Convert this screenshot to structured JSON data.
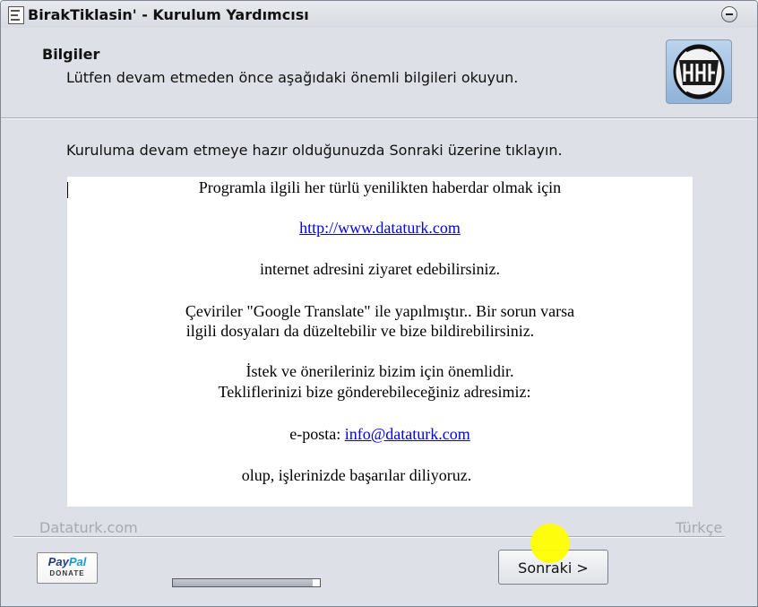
{
  "window": {
    "title": "BirakTiklasin' - Kurulum Yardımcısı",
    "icon": "installer-app-icon",
    "controls": [
      "minimize-icon"
    ]
  },
  "header": {
    "title": "Bilgiler",
    "subtitle": "Lütfen devam etmeden önce aşağıdaki önemli bilgileri okuyun.",
    "logo_icon": "datatürk-emblem-icon"
  },
  "intro_text": "Kuruluma devam etmeye hazır olduğunuzda Sonraki üzerine tıklayın.",
  "info": {
    "line1": "Programla ilgili her türlü yenilikten haberdar olmak için",
    "website_link": "http://www.dataturk.com",
    "line3": "internet adresini ziyaret edebilirsiniz.",
    "line4": "Çeviriler \"Google Translate\" ile yapılmıştır.. Bir sorun varsa",
    "line5": "ilgili dosyaları da düzeltebilir ve bize bildirebilirsiniz.",
    "line6": "İstek ve önerileriniz bizim için önemlidir.",
    "line7": "Tekliflerinizi bize gönderebileceğiniz  adresimiz:",
    "email_prefix": "e-posta: ",
    "email_link": "info@dataturk.com",
    "line9": "olup,  işlerinizde başarılar diliyoruz."
  },
  "footer": {
    "brand": "Dataturk.com",
    "language": "Türkçe",
    "paypal": {
      "word1": "Pay",
      "word2": "Pal",
      "donate": "DONATE"
    },
    "progress_fraction": 0.95,
    "next_button": "Sonraki >"
  },
  "colors": {
    "window_bg": "#dde1e7",
    "link": "#0000ee",
    "cursor_highlight": "#ffff00"
  }
}
